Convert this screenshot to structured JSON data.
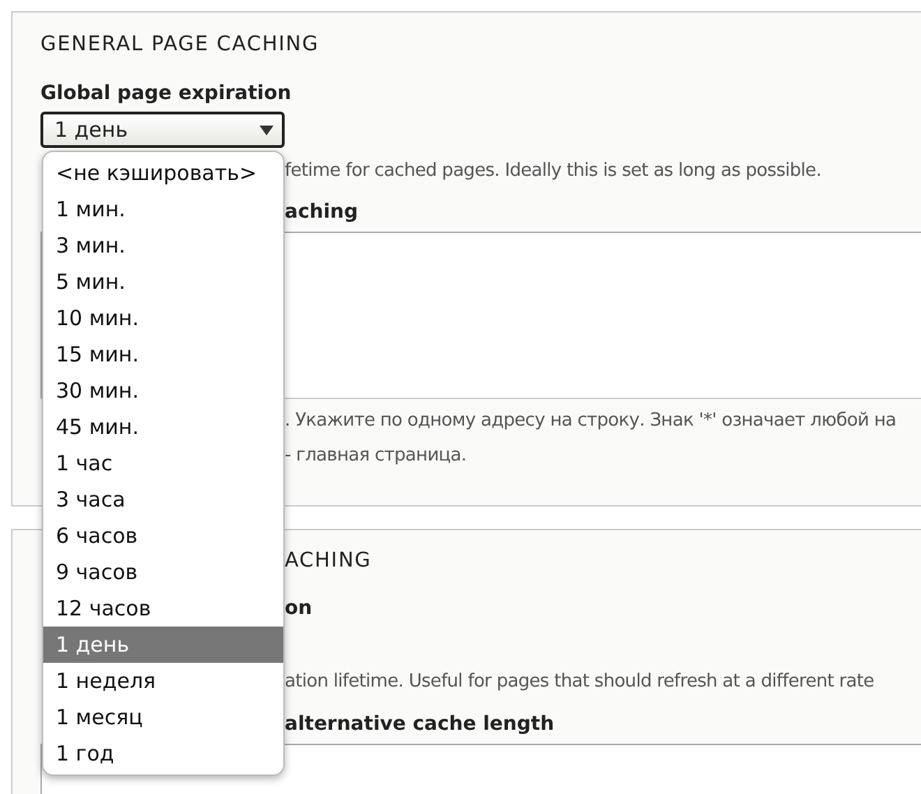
{
  "sections": [
    {
      "title": "GENERAL PAGE CACHING",
      "field_label": "Global page expiration",
      "select": {
        "value": "1 день",
        "expanded": true
      },
      "description": "fetime for cached pages. Ideally this is set as long as possible.",
      "textarea_label": "aching",
      "textarea_description": [
        ". Укажите по одному адресу на строку. Знак '*' означает любой на",
        "- главная страница."
      ]
    },
    {
      "title": "ACHING",
      "field_label": "on",
      "description": "ation lifetime. Useful for pages that should refresh at a different rate",
      "textarea_label": "alternative cache length"
    }
  ],
  "dropdown": {
    "options": [
      {
        "label": "<не кэшировать>",
        "selected": false
      },
      {
        "label": "1 мин.",
        "selected": false
      },
      {
        "label": "3 мин.",
        "selected": false
      },
      {
        "label": "5 мин.",
        "selected": false
      },
      {
        "label": "10 мин.",
        "selected": false
      },
      {
        "label": "15 мин.",
        "selected": false
      },
      {
        "label": "30 мин.",
        "selected": false
      },
      {
        "label": "45 мин.",
        "selected": false
      },
      {
        "label": "1 час",
        "selected": false
      },
      {
        "label": "3 часа",
        "selected": false
      },
      {
        "label": "6 часов",
        "selected": false
      },
      {
        "label": "9 часов",
        "selected": false
      },
      {
        "label": "12 часов",
        "selected": false
      },
      {
        "label": "1 день",
        "selected": true
      },
      {
        "label": "1 неделя",
        "selected": false
      },
      {
        "label": "1 месяц",
        "selected": false
      },
      {
        "label": "1 год",
        "selected": false
      }
    ]
  }
}
